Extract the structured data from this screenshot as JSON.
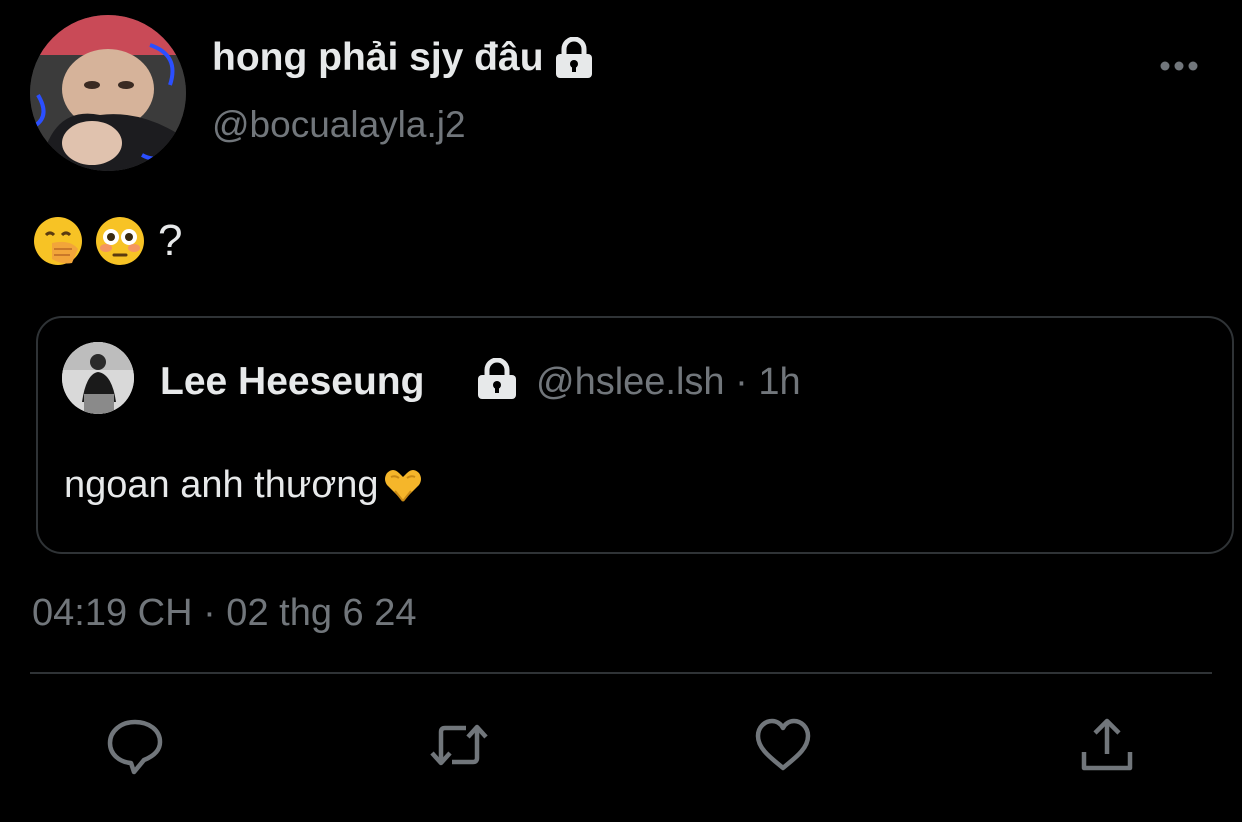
{
  "tweet": {
    "author": {
      "display_name": "hong phải sjy đâu",
      "handle": "@bocualayla.j2",
      "protected_icon": "lock-icon",
      "avatar_icon": "avatar-photo"
    },
    "more_icon": "more-horizontal-icon",
    "text": {
      "emojis": [
        "face-with-hand-over-mouth-emoji",
        "flushed-face-emoji"
      ],
      "suffix": "?"
    },
    "quote": {
      "display_name": "Lee Heeseung",
      "protected_icon": "lock-icon",
      "meta": "@hslee.lsh · 1h",
      "text": "ngoan anh thương",
      "trailing_emoji": "heart-hands-emoji"
    },
    "timestamp": "04:19 CH · 02 thg 6 24",
    "actions": [
      {
        "name": "reply",
        "icon": "reply-icon"
      },
      {
        "name": "retweet",
        "icon": "retweet-icon"
      },
      {
        "name": "like",
        "icon": "heart-icon"
      },
      {
        "name": "share",
        "icon": "share-icon"
      }
    ]
  },
  "colors": {
    "background": "#000000",
    "primary_text": "#e7e9ea",
    "secondary_text": "#71767b",
    "border": "#2f3336"
  }
}
